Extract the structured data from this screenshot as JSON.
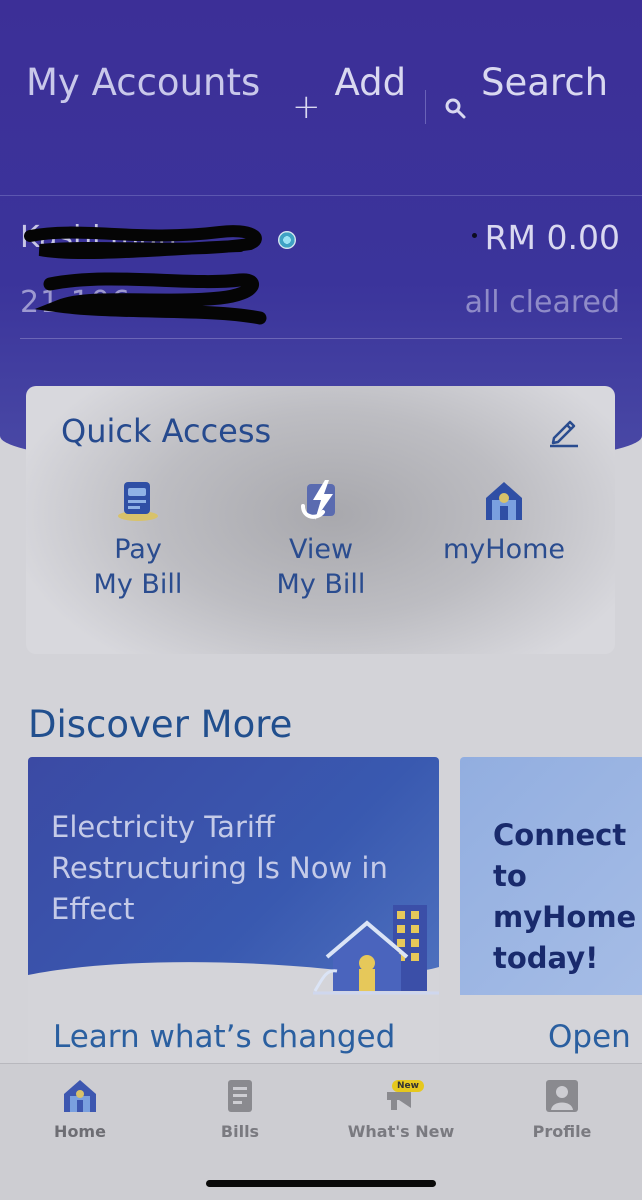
{
  "header": {
    "title": "My Accounts",
    "add_icon": "plus-icon",
    "add_label": "Add",
    "search_icon": "search-icon",
    "search_label": "Search"
  },
  "account": {
    "name": "Kashi man",
    "number": "21 106",
    "amount": "RM 0.00",
    "status": "all cleared"
  },
  "quick_access": {
    "title": "Quick Access",
    "edit_icon": "pencil-icon",
    "items": [
      {
        "icon": "bill-payment-icon",
        "line1": "Pay",
        "line2": "My Bill"
      },
      {
        "icon": "view-bill-icon",
        "line1": "View",
        "line2": "My Bill"
      },
      {
        "icon": "myhome-icon",
        "line1": "myHome",
        "line2": ""
      }
    ]
  },
  "discover": {
    "title": "Discover More",
    "cards": [
      {
        "headline": "Electricity Tariff Restructuring Is Now in Effect",
        "link": "Learn what’s changed"
      },
      {
        "headline": "Connect to myHome today!",
        "link": "Open"
      }
    ]
  },
  "bottom_nav": {
    "items": [
      {
        "icon": "home-icon",
        "label": "Home"
      },
      {
        "icon": "bills-icon",
        "label": "Bills"
      },
      {
        "icon": "megaphone-icon",
        "label": "What's New",
        "badge": "New"
      },
      {
        "icon": "profile-icon",
        "label": "Profile"
      }
    ]
  },
  "colors": {
    "header_bg": "#3c2f97",
    "accent_blue": "#264a8e",
    "badge_yellow": "#e6c81e"
  }
}
